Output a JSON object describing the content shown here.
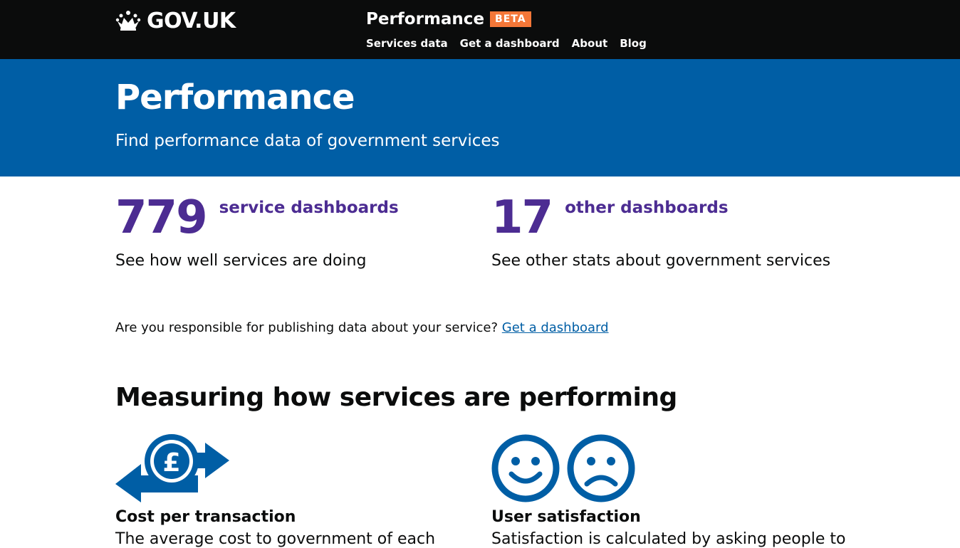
{
  "header": {
    "logo_text": "GOV.UK",
    "product_name": "Performance",
    "badge": "BETA",
    "nav": [
      "Services data",
      "Get a dashboard",
      "About",
      "Blog"
    ]
  },
  "hero": {
    "title": "Performance",
    "subtitle": "Find performance data of government services"
  },
  "stats": [
    {
      "number": "779",
      "link": "service dashboards",
      "description": "See how well services are doing"
    },
    {
      "number": "17",
      "link": "other dashboards",
      "description": "See other stats about government services"
    }
  ],
  "cta": {
    "text": "Are you responsible for publishing data about your service?",
    "link": "Get a dashboard"
  },
  "section": {
    "title": "Measuring how services are performing"
  },
  "metrics": [
    {
      "icon": "pound-exchange-icon",
      "title": "Cost per transaction",
      "description": "The average cost to government of each"
    },
    {
      "icon": "smiley-sad-icons",
      "title": "User satisfaction",
      "description": "Satisfaction is calculated by asking people to"
    }
  ],
  "colors": {
    "header_bg": "#0b0c0c",
    "hero_bg": "#005ea5",
    "stat_purple": "#4c2c92",
    "beta_orange": "#f47738",
    "icon_blue": "#005ea5",
    "link_blue": "#005ea5"
  }
}
